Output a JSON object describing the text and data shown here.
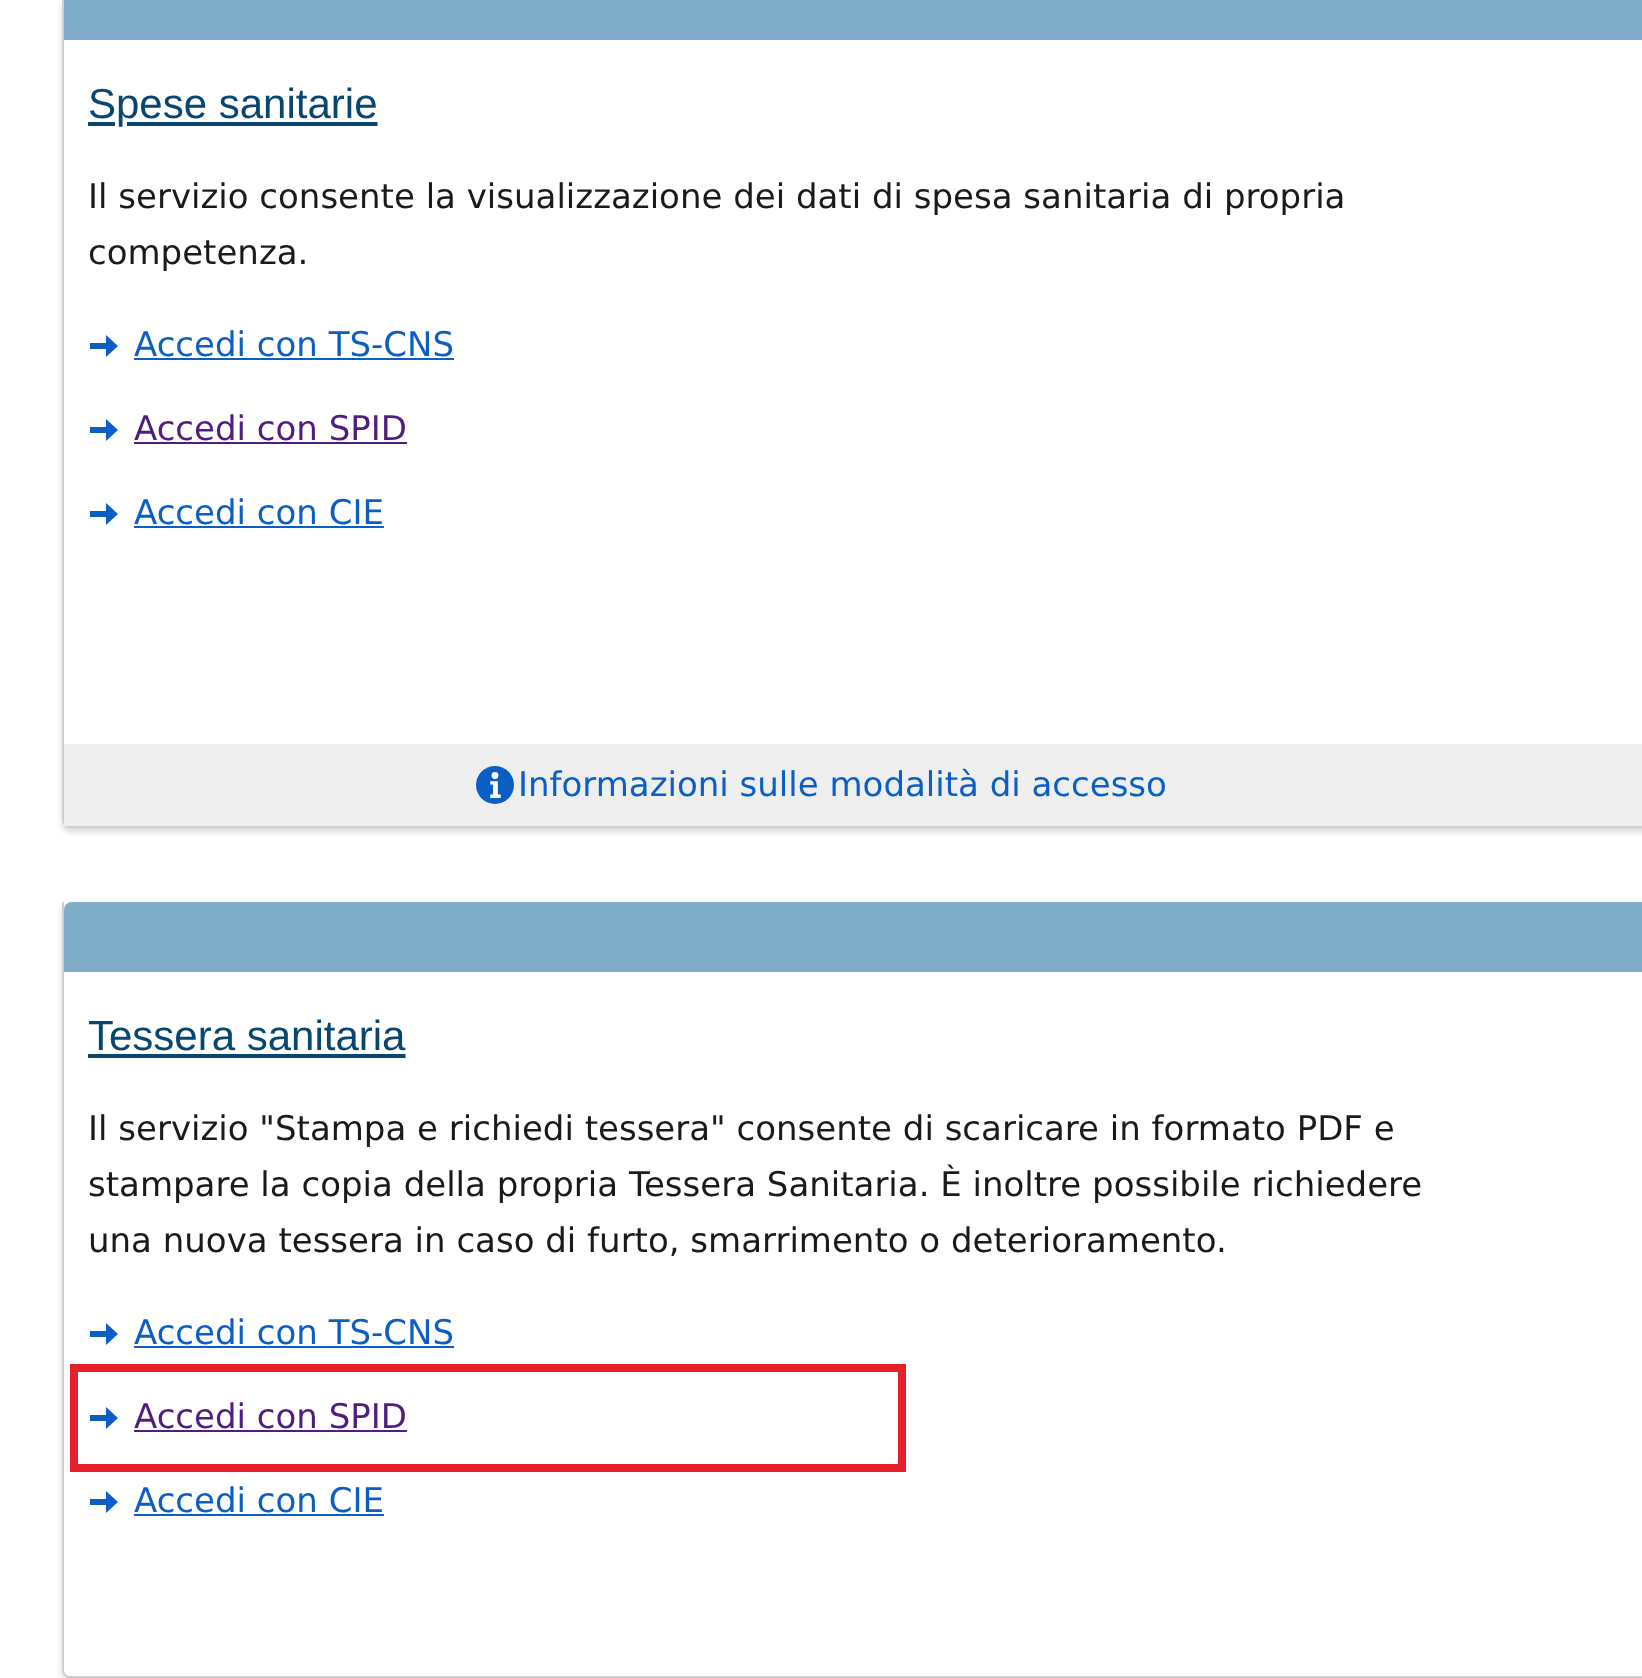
{
  "cards": [
    {
      "header_cropped": true,
      "title": "Spese sanitarie",
      "description": "Il servizio consente la visualizzazione dei dati di spesa sanitaria di propria competenza.",
      "links": [
        {
          "label": "Accedi con TS-CNS",
          "visited": false,
          "highlighted": false
        },
        {
          "label": "Accedi con SPID",
          "visited": true,
          "highlighted": false
        },
        {
          "label": "Accedi con CIE",
          "visited": false,
          "highlighted": false
        }
      ],
      "footer": "Informazioni sulle modalità di accesso"
    },
    {
      "header_cropped": false,
      "title": "Tessera sanitaria",
      "description": "Il servizio \"Stampa e richiedi tessera\" consente di scaricare in formato PDF e stampare la copia della propria Tessera Sanitaria. È inoltre possibile richiedere una nuova tessera in caso di furto, smarrimento o deterioramento.",
      "links": [
        {
          "label": "Accedi con TS-CNS",
          "visited": false,
          "highlighted": false
        },
        {
          "label": "Accedi con SPID",
          "visited": true,
          "highlighted": true
        },
        {
          "label": "Accedi con CIE",
          "visited": false,
          "highlighted": false
        }
      ]
    }
  ]
}
